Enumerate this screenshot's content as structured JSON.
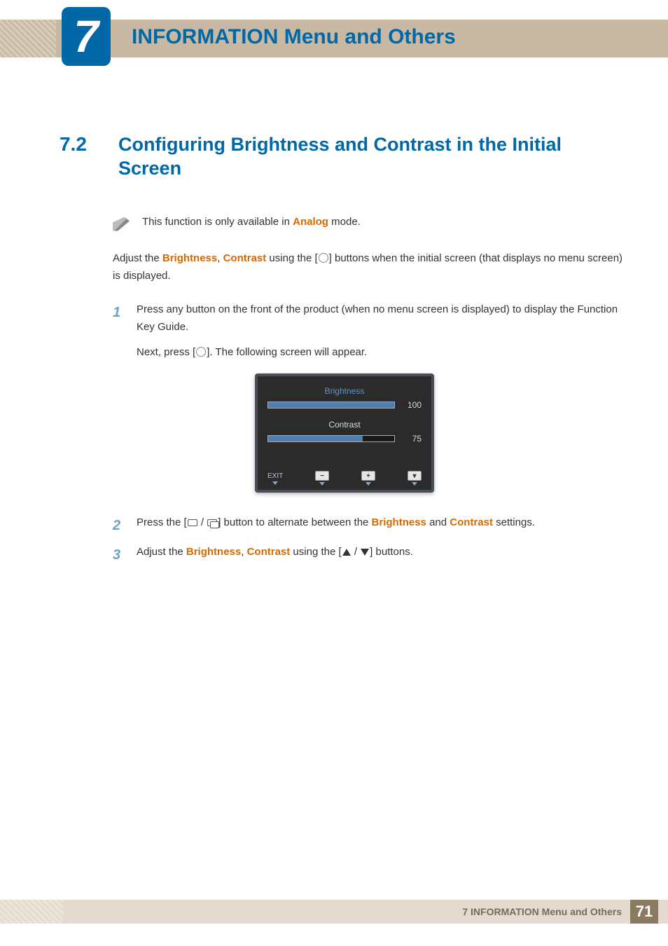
{
  "header": {
    "chapter_number": "7",
    "chapter_title": "INFORMATION Menu and Others"
  },
  "section": {
    "number": "7.2",
    "title": "Configuring Brightness and Contrast in the Initial Screen"
  },
  "note": {
    "prefix": "This function is only available in ",
    "mode": "Analog",
    "suffix": " mode."
  },
  "intro": {
    "p1a": "Adjust the ",
    "b1": "Brightness",
    "sep": ", ",
    "b2": "Contrast",
    "p1b": " using the [",
    "p1c": "] buttons when the initial screen (that displays no menu screen) is displayed."
  },
  "steps": {
    "s1": {
      "num": "1",
      "l1": "Press any button on the front of the product (when no menu screen is displayed) to display the Function Key Guide.",
      "l2a": "Next, press [",
      "l2b": "]. The following screen will appear."
    },
    "s2": {
      "num": "2",
      "a": "Press the [",
      "b": "] button to alternate between the ",
      "h1": "Brightness",
      "and": " and ",
      "h2": "Contrast",
      "c": " settings."
    },
    "s3": {
      "num": "3",
      "a": "Adjust the ",
      "h1": "Brightness",
      "sep": ", ",
      "h2": "Contrast",
      "b": " using the [",
      "c": "] buttons."
    }
  },
  "osd": {
    "brightness_label": "Brightness",
    "brightness_value": "100",
    "brightness_pct": 100,
    "contrast_label": "Contrast",
    "contrast_value": "75",
    "contrast_pct": 75,
    "exit": "EXIT",
    "minus": "−",
    "plus": "+",
    "down": "▾"
  },
  "footer": {
    "text": "7 INFORMATION Menu and Others",
    "page": "71"
  }
}
